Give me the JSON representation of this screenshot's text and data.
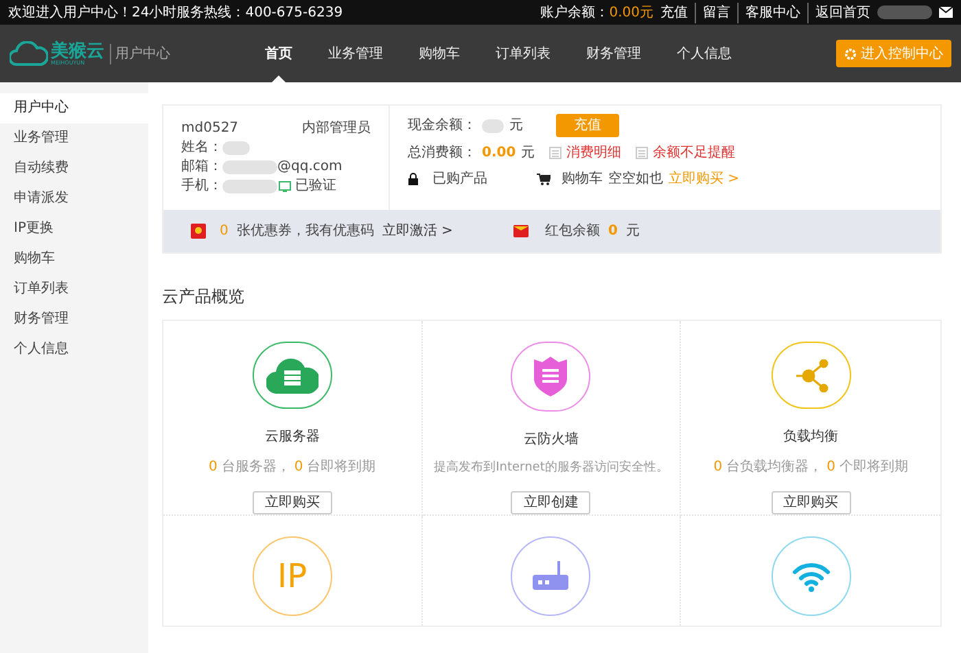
{
  "top_bar": {
    "welcome": "欢迎进入用户中心！24小时服务热线：400-675-6239",
    "balance_label": "账户余额：",
    "balance_value": "0.00元",
    "links": [
      "充值",
      "留言",
      "客服中心",
      "返回首页"
    ]
  },
  "nav": {
    "logo_text": "美猴云",
    "logo_sub": "MEIHOUYUN",
    "section": "用户中心",
    "items": [
      {
        "label": "首页",
        "selected": true
      },
      {
        "label": "业务管理",
        "selected": false
      },
      {
        "label": "购物车",
        "selected": false
      },
      {
        "label": "订单列表",
        "selected": false
      },
      {
        "label": "财务管理",
        "selected": false
      },
      {
        "label": "个人信息",
        "selected": false
      }
    ],
    "console_button": "进入控制中心"
  },
  "sidebar": {
    "items": [
      {
        "label": "用户中心",
        "selected": true
      },
      {
        "label": "业务管理",
        "selected": false
      },
      {
        "label": "自动续费",
        "selected": false
      },
      {
        "label": "申请派发",
        "selected": false
      },
      {
        "label": "IP更换",
        "selected": false
      },
      {
        "label": "购物车",
        "selected": false
      },
      {
        "label": "订单列表",
        "selected": false
      },
      {
        "label": "财务管理",
        "selected": false
      },
      {
        "label": "个人信息",
        "selected": false
      }
    ]
  },
  "account": {
    "username": "md0527",
    "role": "内部管理员",
    "name_label": "姓名：",
    "email_label": "邮箱：",
    "email_suffix": "@qq.com",
    "phone_label": "手机：",
    "phone_status": "已验证",
    "cash_label": "现金余额：",
    "cash_unit": "元",
    "recharge_button": "充值",
    "spent_label": "总消费额：",
    "spent_value": "0.00",
    "spent_unit": "元",
    "details_link": "消费明细",
    "low_balance_link": "余额不足提醒",
    "bought_label": "已购产品",
    "cart_label": "购物车",
    "cart_text": "空空如也",
    "buy_link": "立即购买 >"
  },
  "coupons": {
    "count": "0",
    "text": "张优惠券，我有优惠码",
    "activate_link": "立即激活 >",
    "redpacket_label": "红包余额",
    "redpacket_value": "0",
    "redpacket_unit": "元"
  },
  "overview": {
    "title": "云产品概览",
    "products": [
      {
        "kind": "cloud",
        "name": "云服务器",
        "stats": [
          {
            "count": "0",
            "label": "台服务器，"
          },
          {
            "count": "0",
            "label": "台即将到期"
          }
        ],
        "button": "立即购买"
      },
      {
        "kind": "firewall",
        "name": "云防火墙",
        "description": "提高发布到Internet的服务器访问安全性。",
        "button": "立即创建"
      },
      {
        "kind": "share",
        "name": "负载均衡",
        "stats": [
          {
            "count": "0",
            "label": "台负载均衡器，"
          },
          {
            "count": "0",
            "label": "个即将到期"
          }
        ],
        "button": "立即购买"
      },
      {
        "kind": "ip",
        "icon_text": "IP"
      },
      {
        "kind": "router"
      },
      {
        "kind": "wifi"
      }
    ]
  }
}
